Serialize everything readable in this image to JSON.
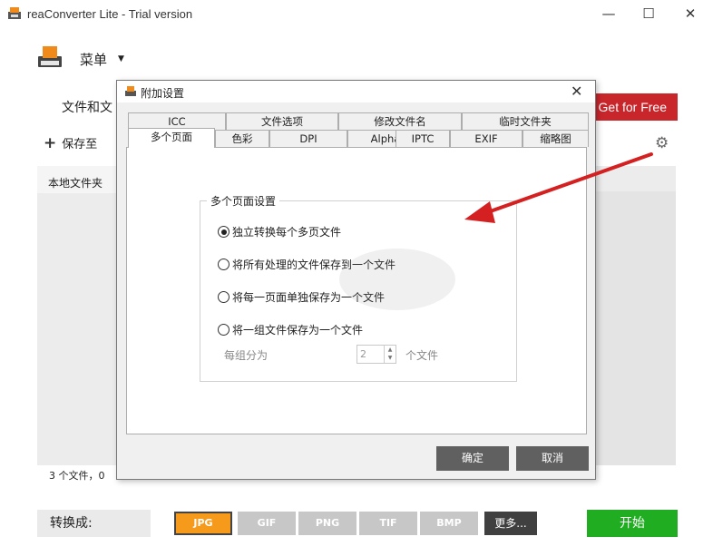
{
  "window": {
    "title": "reaConverter Lite - Trial version",
    "minimize": "—",
    "maximize": "☐",
    "close": "✕"
  },
  "menu": {
    "label": "菜单",
    "caret": "▼"
  },
  "files_title": "文件和文",
  "get_free": "Get for Free",
  "saveto": {
    "plus": "+",
    "label": "保存至"
  },
  "gear": "⚙",
  "local_folder": "本地文件夹",
  "status": "3 个文件，0",
  "convert": {
    "label": "转换成:"
  },
  "formats": [
    "JPG",
    "GIF",
    "PNG",
    "TIF",
    "BMP"
  ],
  "more_label": "更多...",
  "start_label": "开始",
  "dialog": {
    "title": "附加设置",
    "close": "✕",
    "tabs_row1": [
      "ICC",
      "文件选项",
      "修改文件名",
      "临时文件夹"
    ],
    "tabs_row2": [
      "多个页面",
      "色彩",
      "DPI",
      "Alpha",
      "IPTC",
      "EXIF",
      "缩略图"
    ],
    "group_title": "多个页面设置",
    "options": [
      {
        "label": "独立转换每个多页文件",
        "checked": true
      },
      {
        "label": "将所有处理的文件保存到一个文件",
        "checked": false
      },
      {
        "label": "将每一页面单独保存为一个文件",
        "checked": false
      },
      {
        "label": "将一组文件保存为一个文件",
        "checked": false
      }
    ],
    "per_group_label": "每组分为",
    "per_group_value": "2",
    "files_unit": "个文件",
    "ok": "确定",
    "cancel": "取消"
  },
  "colors": {
    "accent_red": "#c9262c",
    "jpg_orange": "#f59a1a",
    "start_green": "#21ad21",
    "arrow_red": "#d42020"
  }
}
